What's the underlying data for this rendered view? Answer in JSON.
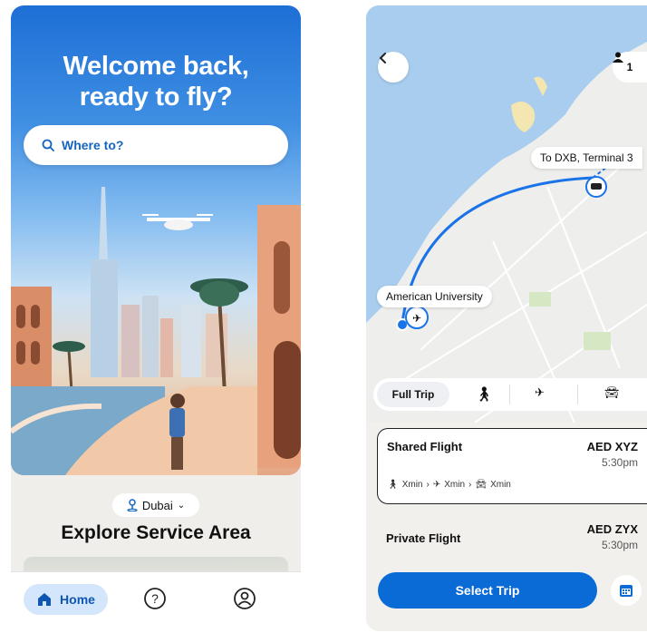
{
  "home": {
    "title_line1": "Welcome back,",
    "title_line2": "ready to fly?",
    "search_placeholder": "Where to?",
    "city": "Dubai",
    "section_title": "Explore Service Area",
    "tabs": {
      "home": "Home"
    }
  },
  "trip": {
    "passenger_count": "1",
    "destination_label": "To DXB, Terminal 3",
    "origin_label": "American University",
    "modes": {
      "full_trip": "Full Trip"
    },
    "options": [
      {
        "name": "Shared Flight",
        "price": "AED XYZ",
        "time": "5:30pm",
        "legs": {
          "walk": "Xmin",
          "fly": "Xmin",
          "drive": "Xmin"
        }
      },
      {
        "name": "Private Flight",
        "price": "AED ZYX",
        "time": "5:30pm"
      }
    ],
    "cta": "Select Trip"
  },
  "colors": {
    "brand_blue": "#0b6bd6",
    "route_blue": "#1a73e8",
    "selected_tab_bg": "#d4e6fb"
  }
}
